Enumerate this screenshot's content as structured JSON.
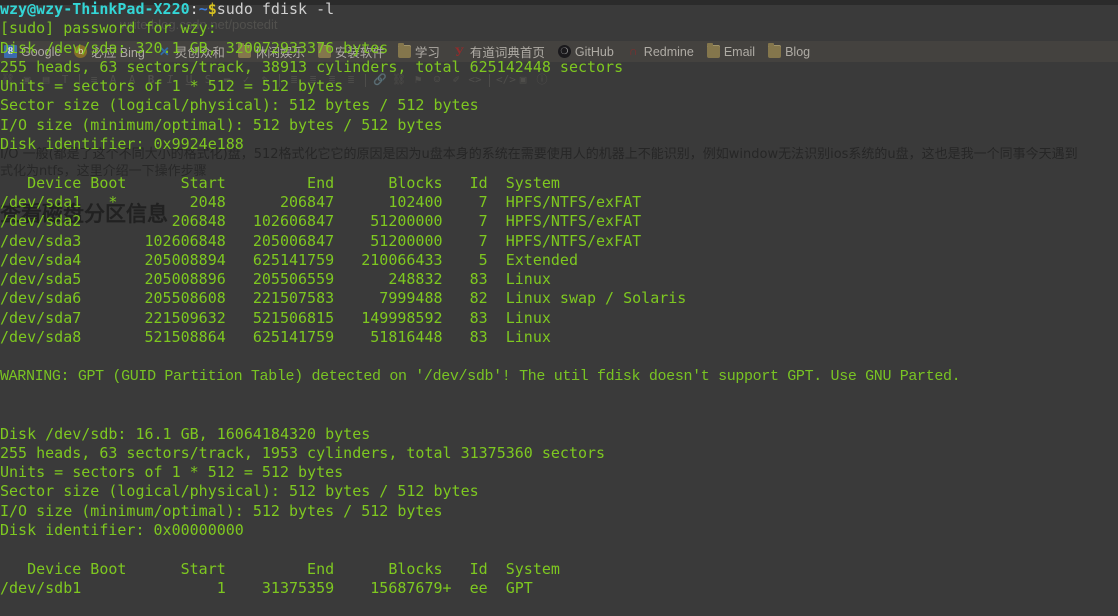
{
  "window": {
    "title": "wzy@wzy-ThinkPad-X220: ~",
    "app": "terminal",
    "bg_color": "#3a3a3a",
    "fg_color": "#7ec820"
  },
  "background_browser": {
    "url_ghost": "write.blog.csdn.net/postedit",
    "bookmarks_label": "bookmarks-bar",
    "bookmarks": [
      {
        "label": "Google",
        "icon": "google-icon",
        "glyph": "8"
      },
      {
        "label": "必应 Bing",
        "icon": "bing-icon",
        "glyph": "b"
      },
      {
        "label": "灵创众和",
        "icon": "lingchuang-icon",
        "glyph": "✕"
      },
      {
        "label": "休闲娱乐",
        "icon": "folder-icon",
        "glyph": ""
      },
      {
        "label": "安装软件",
        "icon": "folder-icon",
        "glyph": ""
      },
      {
        "label": "学习",
        "icon": "folder-icon",
        "glyph": ""
      },
      {
        "label": "有道词典首页",
        "icon": "youdao-icon",
        "glyph": "У"
      },
      {
        "label": "GitHub",
        "icon": "github-icon",
        "glyph": "❍"
      },
      {
        "label": "Redmine",
        "icon": "redmine-icon",
        "glyph": "∩"
      },
      {
        "label": "Email",
        "icon": "folder-icon",
        "glyph": ""
      },
      {
        "label": "Blog",
        "icon": "folder-icon",
        "glyph": ""
      }
    ],
    "editor_toolbar_icons": [
      "link-icon",
      "image-icon",
      "table-icon",
      "text-icon",
      "indent-icon",
      "font-color-icon",
      "font-size-icon",
      "bold-icon",
      "italic-icon",
      "underline-icon",
      "strikethrough-icon",
      "highlight-icon",
      "check-icon",
      "eraser-icon",
      "align-left-icon",
      "align-center-icon",
      "align-right-icon",
      "align-justify-icon",
      "insert-link-icon",
      "unlink-icon",
      "anchor-icon",
      "emoji-icon",
      "edit-icon",
      "code-icon",
      "source-icon",
      "page-break-icon",
      "info-icon"
    ],
    "article_text_line1": "I/O 一般(都是了这个不同大小的格式化)盘，512格式化它它的原因是因为u盘本身的系统在需要使用人的机器上不能识别，例如window无法识别ios系统的u盘，这也是我一个同事今天遇到",
    "article_text_line2": "式化为ntfs，这里介绍一下操作步骤",
    "article_heading": "查看磁盘分区信息"
  },
  "terminal": {
    "prompt": {
      "user_host": "wzy@wzy-ThinkPad-X220",
      "colon": ":",
      "path": "~",
      "sigil": "$",
      "command": "sudo fdisk -l"
    },
    "sudo_prompt": "[sudo] password for wzy:",
    "disks": [
      {
        "header_lines": [
          "Disk /dev/sda: 320.1 GB, 320072933376 bytes",
          "255 heads, 63 sectors/track, 38913 cylinders, total 625142448 sectors",
          "Units = sectors of 1 * 512 = 512 bytes",
          "Sector size (logical/physical): 512 bytes / 512 bytes",
          "I/O size (minimum/optimal): 512 bytes / 512 bytes",
          "Disk identifier: 0x9924e188"
        ],
        "table_header": "   Device Boot      Start         End      Blocks   Id  System",
        "rows": [
          "/dev/sda1   *        2048      206847      102400    7  HPFS/NTFS/exFAT",
          "/dev/sda2          206848   102606847    51200000    7  HPFS/NTFS/exFAT",
          "/dev/sda3       102606848   205006847    51200000    7  HPFS/NTFS/exFAT",
          "/dev/sda4       205008894   625141759   210066433    5  Extended",
          "/dev/sda5       205008896   205506559      248832   83  Linux",
          "/dev/sda6       205508608   221507583     7999488   82  Linux swap / Solaris",
          "/dev/sda7       221509632   521506815   149998592   83  Linux",
          "/dev/sda8       521508864   625141759    51816448   83  Linux"
        ]
      },
      {
        "header_lines": [
          "Disk /dev/sdb: 16.1 GB, 16064184320 bytes",
          "255 heads, 63 sectors/track, 1953 cylinders, total 31375360 sectors",
          "Units = sectors of 1 * 512 = 512 bytes",
          "Sector size (logical/physical): 512 bytes / 512 bytes",
          "I/O size (minimum/optimal): 512 bytes / 512 bytes",
          "Disk identifier: 0x00000000"
        ],
        "table_header": "   Device Boot      Start         End      Blocks   Id  System",
        "rows": [
          "/dev/sdb1               1    31375359    15687679+  ee  GPT"
        ]
      }
    ],
    "warning": "WARNING: GPT (GUID Partition Table) detected on '/dev/sdb'! The util fdisk doesn't support GPT. Use GNU Parted."
  }
}
